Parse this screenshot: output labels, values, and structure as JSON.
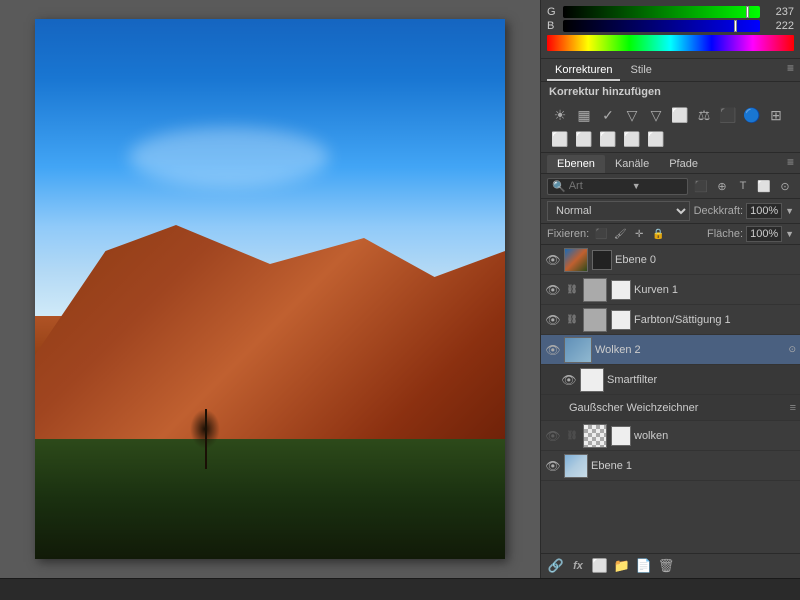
{
  "colors": {
    "g_value": "237",
    "b_value": "222",
    "accent": "#4a6080"
  },
  "panel_tabs": {
    "tab1": "Korrekturen",
    "tab2": "Stile",
    "header": "Korrektur hinzufügen"
  },
  "layer_tabs": {
    "tab1": "Ebenen",
    "tab2": "Kanäle",
    "tab3": "Pfade"
  },
  "blend": {
    "mode": "Normal",
    "opacity_label": "Deckkraft:",
    "opacity_value": "100%",
    "flaeche_label": "Fläche:",
    "flaeche_value": "100%"
  },
  "fixieren": {
    "label": "Fixieren:"
  },
  "search": {
    "placeholder": "Art"
  },
  "layers": [
    {
      "name": "Ebene 0",
      "thumb": "ebene0",
      "mask": "black",
      "visible": true,
      "selected": false
    },
    {
      "name": "Kurven 1",
      "thumb": "gray",
      "mask": "white",
      "visible": true,
      "selected": false
    },
    {
      "name": "Farbton/Sättigung 1",
      "thumb": "gray",
      "mask": "white",
      "visible": true,
      "selected": false
    },
    {
      "name": "Wolken 2",
      "thumb": "wolken2",
      "mask": "none",
      "visible": true,
      "selected": true,
      "smart": true
    },
    {
      "name": "Smartfilter",
      "thumb": "white",
      "mask": "none",
      "visible": true,
      "selected": false,
      "sub": true
    },
    {
      "name": "Gaußscher Weichzeichner",
      "thumb": "none",
      "mask": "none",
      "visible": false,
      "selected": false,
      "sub2": true
    },
    {
      "name": "wolken",
      "thumb": "checker",
      "mask": "white",
      "visible": false,
      "selected": false
    },
    {
      "name": "Ebene 1",
      "thumb": "wolken",
      "mask": "none",
      "visible": true,
      "selected": false
    }
  ],
  "bottom_icons": [
    "link",
    "fx",
    "mask",
    "group",
    "folder",
    "trash"
  ]
}
